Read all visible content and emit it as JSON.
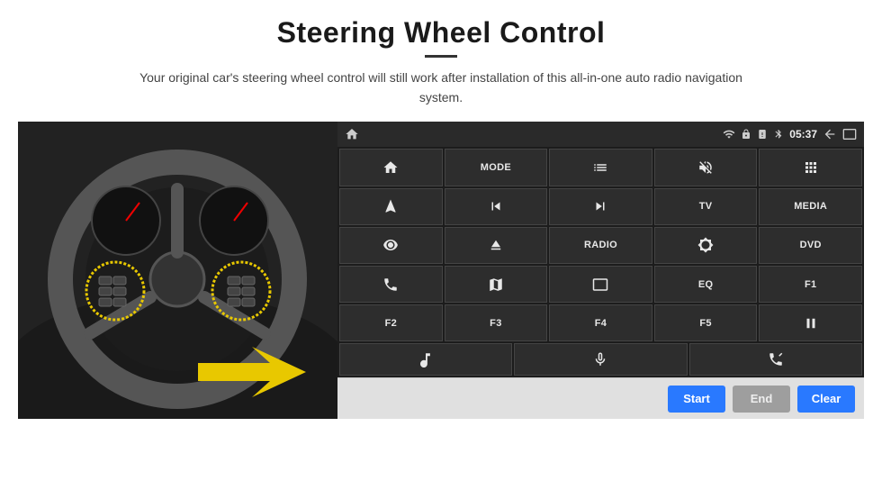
{
  "page": {
    "title": "Steering Wheel Control",
    "subtitle": "Your original car's steering wheel control will still work after installation of this all-in-one auto radio navigation system."
  },
  "status_bar": {
    "time": "05:37",
    "icons": [
      "wifi",
      "lock",
      "sim",
      "bluetooth",
      "back",
      "home"
    ]
  },
  "button_grid": [
    {
      "id": "home",
      "type": "icon",
      "icon": "home",
      "label": ""
    },
    {
      "id": "mode",
      "type": "text",
      "label": "MODE"
    },
    {
      "id": "list",
      "type": "icon",
      "icon": "list",
      "label": ""
    },
    {
      "id": "mute",
      "type": "icon",
      "icon": "mute",
      "label": ""
    },
    {
      "id": "apps",
      "type": "icon",
      "icon": "apps",
      "label": ""
    },
    {
      "id": "nav",
      "type": "icon",
      "icon": "nav",
      "label": ""
    },
    {
      "id": "prev",
      "type": "icon",
      "icon": "prev",
      "label": ""
    },
    {
      "id": "next",
      "type": "icon",
      "icon": "next",
      "label": ""
    },
    {
      "id": "tv",
      "type": "text",
      "label": "TV"
    },
    {
      "id": "media",
      "type": "text",
      "label": "MEDIA"
    },
    {
      "id": "360",
      "type": "icon",
      "icon": "360",
      "label": ""
    },
    {
      "id": "eject",
      "type": "icon",
      "icon": "eject",
      "label": ""
    },
    {
      "id": "radio",
      "type": "text",
      "label": "RADIO"
    },
    {
      "id": "brightness",
      "type": "icon",
      "icon": "brightness",
      "label": ""
    },
    {
      "id": "dvd",
      "type": "text",
      "label": "DVD"
    },
    {
      "id": "phone",
      "type": "icon",
      "icon": "phone",
      "label": ""
    },
    {
      "id": "map",
      "type": "icon",
      "icon": "map",
      "label": ""
    },
    {
      "id": "display",
      "type": "icon",
      "icon": "display",
      "label": ""
    },
    {
      "id": "eq",
      "type": "text",
      "label": "EQ"
    },
    {
      "id": "f1",
      "type": "text",
      "label": "F1"
    },
    {
      "id": "f2",
      "type": "text",
      "label": "F2"
    },
    {
      "id": "f3",
      "type": "text",
      "label": "F3"
    },
    {
      "id": "f4",
      "type": "text",
      "label": "F4"
    },
    {
      "id": "f5",
      "type": "text",
      "label": "F5"
    },
    {
      "id": "playpause",
      "type": "icon",
      "icon": "playpause",
      "label": ""
    }
  ],
  "last_row": [
    {
      "id": "music",
      "type": "icon",
      "icon": "music",
      "label": ""
    },
    {
      "id": "mic",
      "type": "icon",
      "icon": "mic",
      "label": ""
    },
    {
      "id": "call",
      "type": "icon",
      "icon": "call",
      "label": ""
    }
  ],
  "bottom_bar": {
    "start_label": "Start",
    "end_label": "End",
    "clear_label": "Clear"
  }
}
